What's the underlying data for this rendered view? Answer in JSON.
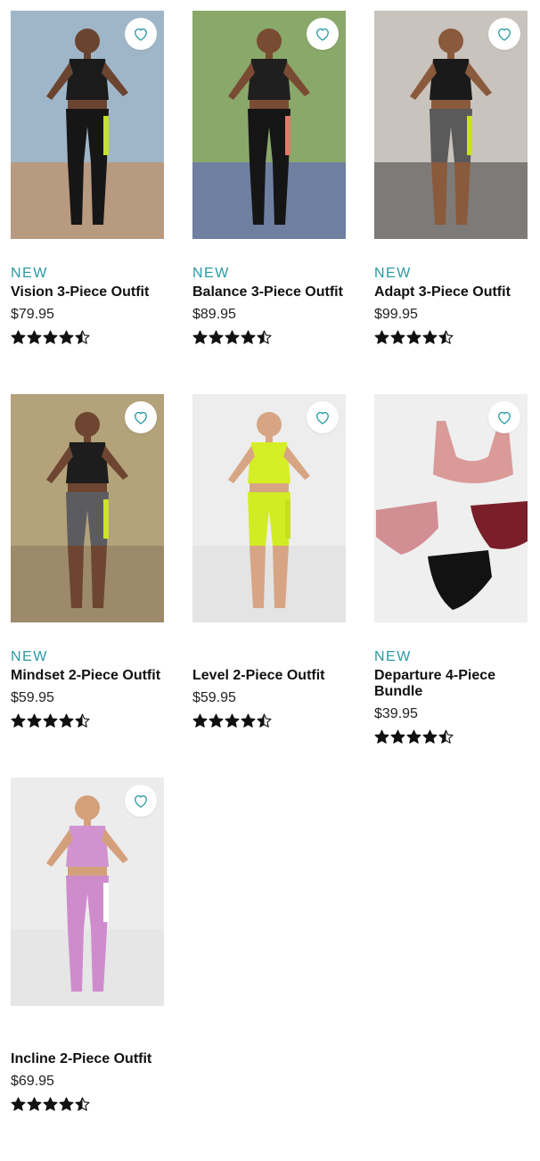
{
  "colors": {
    "accent": "#2a9aa3",
    "star": "#111111"
  },
  "products": [
    {
      "badge": "NEW",
      "name": "Vision 3-Piece Outfit",
      "price": "$79.95",
      "rating": 4.5,
      "image": {
        "bg": "#9fb6c8",
        "ground": "#b89a80",
        "top": "#1b1b1b",
        "bottom": "#161616",
        "accent": "#c6e12a",
        "skin": "#6b4430"
      }
    },
    {
      "badge": "NEW",
      "name": "Balance 3-Piece Outfit",
      "price": "$89.95",
      "rating": 4.5,
      "image": {
        "bg": "#8aa86a",
        "ground": "#6f7fa0",
        "top": "#1f1f1f",
        "bottom": "#151515",
        "accent": "#e07a6a",
        "skin": "#7a4b33"
      }
    },
    {
      "badge": "NEW",
      "name": "Adapt 3-Piece Outfit",
      "price": "$99.95",
      "rating": 4.5,
      "image": {
        "bg": "#c9c3bd",
        "ground": "#7d7a77",
        "top": "#1a1a1a",
        "bottom": "#5a5a5a",
        "accent": "#c9e21b",
        "skin": "#8a5a3c"
      }
    },
    {
      "badge": "NEW",
      "name": "Mindset 2-Piece Outfit",
      "price": "$59.95",
      "rating": 4.5,
      "image": {
        "bg": "#b3a27a",
        "ground": "#9c8a6a",
        "top": "#1d1d1d",
        "bottom": "#5c5c60",
        "accent": "#cde32a",
        "skin": "#6d4530"
      }
    },
    {
      "badge": "",
      "name": "Level 2-Piece Outfit",
      "price": "$59.95",
      "rating": 4.5,
      "image": {
        "bg": "#ededed",
        "ground": "#e4e4e4",
        "top": "#d6ee25",
        "bottom": "#d2ec23",
        "accent": "#c6e01a",
        "skin": "#d7a583"
      }
    },
    {
      "badge": "NEW",
      "name": "Departure 4-Piece Bundle",
      "price": "$39.95",
      "rating": 4.5,
      "image": {
        "bg": "#efefef",
        "ground": "#efefef",
        "top": "#d99a98",
        "bottom": "#d28f93",
        "accent": "#7a1f2a",
        "skin": "#121212"
      }
    },
    {
      "badge": "",
      "name": "Incline 2-Piece Outfit",
      "price": "$69.95",
      "rating": 4.5,
      "image": {
        "bg": "#ececec",
        "ground": "#e6e6e6",
        "top": "#d193cf",
        "bottom": "#cf8ccd",
        "accent": "#ffffff",
        "skin": "#d4a07c"
      }
    }
  ],
  "ui": {
    "favorite_icon": "heart-outline-icon",
    "star_icon": "star-icon"
  }
}
